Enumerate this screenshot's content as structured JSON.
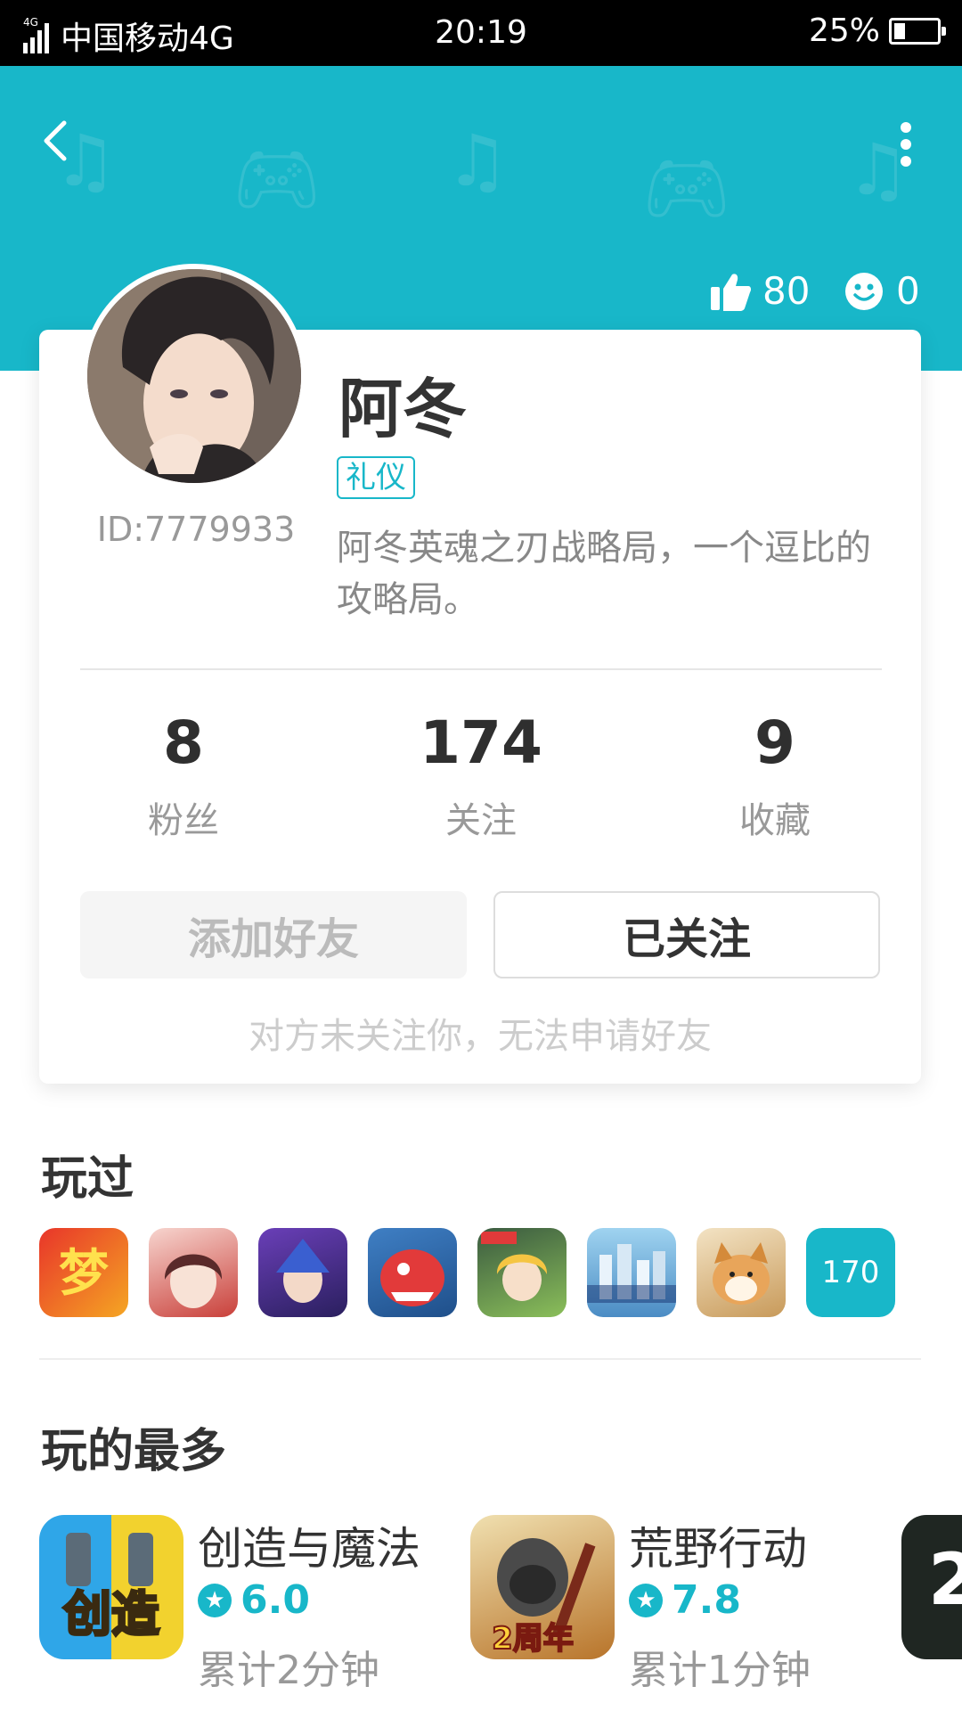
{
  "status_bar": {
    "network_tag": "4G",
    "carrier": "中国移动4G",
    "time": "20:19",
    "battery": "25%",
    "battery_level": 0.25
  },
  "header": {
    "likes": "80",
    "smiles": "0",
    "accent_color": "#18b7c9"
  },
  "profile": {
    "name": "阿冬",
    "tag": "礼仪",
    "id": "ID:7779933",
    "bio": "阿冬英魂之刃战略局，一个逗比的攻略局。"
  },
  "stats": [
    {
      "value": "8",
      "label": "粉丝"
    },
    {
      "value": "174",
      "label": "关注"
    },
    {
      "value": "9",
      "label": "收藏"
    }
  ],
  "actions": {
    "add_friend": "添加好友",
    "followed": "已关注",
    "hint": "对方未关注你，无法申请好友"
  },
  "played": {
    "title": "玩过",
    "more_count": "170",
    "icons": [
      "game-icon-meng",
      "game-icon-anime-girl",
      "game-icon-hero",
      "game-icon-dragon",
      "game-icon-anniversary",
      "game-icon-city",
      "game-icon-shiba"
    ]
  },
  "most_played": {
    "title": "玩的最多",
    "items": [
      {
        "name": "创造与魔法",
        "score": "6.0",
        "time": "累计2分钟"
      },
      {
        "name": "荒野行动",
        "score": "7.8",
        "time": "累计1分钟"
      }
    ]
  }
}
